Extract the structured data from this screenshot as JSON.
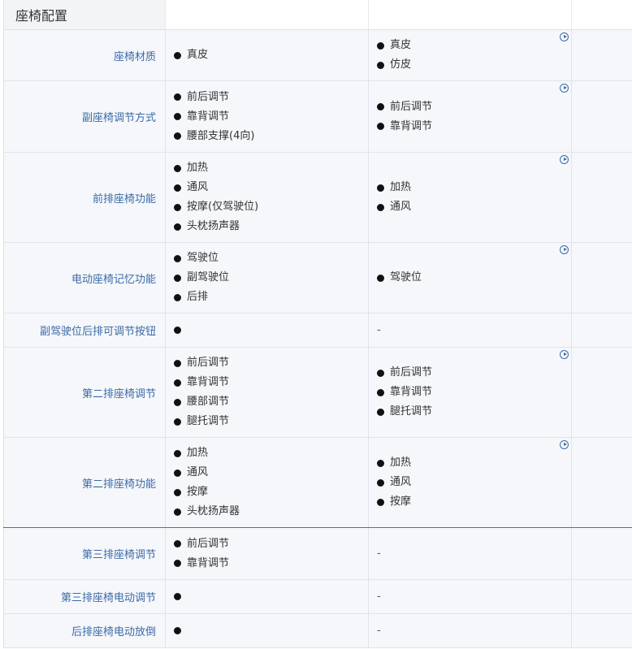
{
  "section": {
    "title": "座椅配置"
  },
  "rows": [
    {
      "label": "座椅材质",
      "col1": [
        "真皮"
      ],
      "col2": [
        "真皮",
        "仿皮"
      ],
      "col2_icon": true
    },
    {
      "label": "副座椅调节方式",
      "col1": [
        "前后调节",
        "靠背调节",
        "腰部支撑(4向)"
      ],
      "col2": [
        "前后调节",
        "靠背调节"
      ],
      "col2_icon": true
    },
    {
      "label": "前排座椅功能",
      "col1": [
        "加热",
        "通风",
        "按摩(仅驾驶位)",
        "头枕扬声器"
      ],
      "col2": [
        "加热",
        "通风"
      ],
      "col2_icon": true
    },
    {
      "label": "电动座椅记忆功能",
      "col1": [
        "驾驶位",
        "副驾驶位",
        "后排"
      ],
      "col2": [
        "驾驶位"
      ],
      "col2_icon": true
    },
    {
      "label": "副驾驶位后排可调节按钮",
      "col1": [
        ""
      ],
      "col2_dash": "-",
      "col2_icon": false
    },
    {
      "label": "第二排座椅调节",
      "col1": [
        "前后调节",
        "靠背调节",
        "腰部调节",
        "腿托调节"
      ],
      "col2": [
        "前后调节",
        "靠背调节",
        "腿托调节"
      ],
      "col2_icon": true
    },
    {
      "label": "第二排座椅功能",
      "col1": [
        "加热",
        "通风",
        "按摩",
        "头枕扬声器"
      ],
      "col2": [
        "加热",
        "通风",
        "按摩"
      ],
      "col2_icon": true
    },
    {
      "label": "第三排座椅调节",
      "col1": [
        "前后调节",
        "靠背调节"
      ],
      "col2_dash": "-",
      "col2_icon": false
    },
    {
      "label": "第三排座椅电动调节",
      "col1": [
        ""
      ],
      "col2_dash": "-",
      "col2_icon": false
    },
    {
      "label": "后排座椅电动放倒",
      "col1": [
        ""
      ],
      "col2_dash": "-",
      "col2_icon": false
    }
  ],
  "icons": {
    "expand": "play-circle-icon"
  },
  "colors": {
    "label_text": "#3b6aa8",
    "row_bg": "#f5f7fa",
    "header_bg": "#f3f4f6",
    "divider_accent": "#e2383b"
  }
}
